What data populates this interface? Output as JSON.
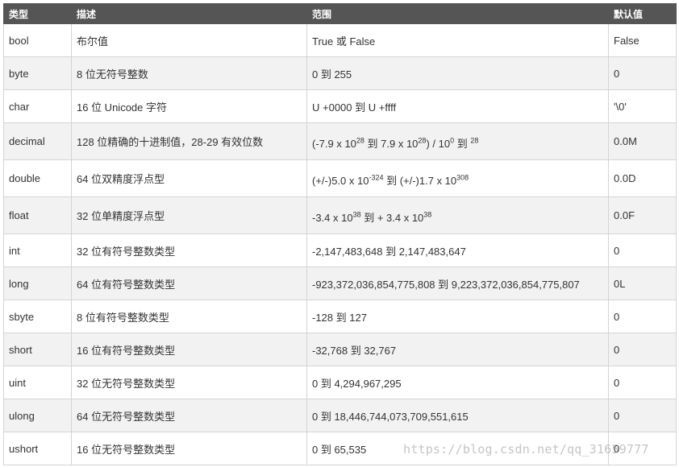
{
  "header": {
    "type": "类型",
    "desc": "描述",
    "range": "范围",
    "default": "默认值"
  },
  "rows": [
    {
      "type": "bool",
      "desc": "布尔值",
      "range_text": "True 或 False",
      "default": "False"
    },
    {
      "type": "byte",
      "desc": "8 位无符号整数",
      "range_text": "0 到 255",
      "default": "0"
    },
    {
      "type": "char",
      "desc": "16 位 Unicode 字符",
      "range_text": "U +0000 到 U +ffff",
      "default": "'\\0'"
    },
    {
      "type": "decimal",
      "desc": "128 位精确的十进制值，28-29 有效位数",
      "range_parts": [
        "(-7.9 x 10",
        "28",
        " 到 7.9 x 10",
        "28",
        ") / 10",
        "0",
        " 到 ",
        "28",
        ""
      ],
      "default": "0.0M"
    },
    {
      "type": "double",
      "desc": "64 位双精度浮点型",
      "range_parts": [
        "(+/-)5.0 x 10",
        "-324",
        " 到 (+/-)1.7 x 10",
        "308",
        ""
      ],
      "default": "0.0D"
    },
    {
      "type": "float",
      "desc": "32 位单精度浮点型",
      "range_parts": [
        "-3.4 x 10",
        "38",
        " 到 + 3.4 x 10",
        "38",
        ""
      ],
      "default": "0.0F"
    },
    {
      "type": "int",
      "desc": "32 位有符号整数类型",
      "range_text": "-2,147,483,648 到 2,147,483,647",
      "default": "0"
    },
    {
      "type": "long",
      "desc": "64 位有符号整数类型",
      "range_text": "-923,372,036,854,775,808 到 9,223,372,036,854,775,807",
      "default": "0L"
    },
    {
      "type": "sbyte",
      "desc": "8 位有符号整数类型",
      "range_text": "-128 到 127",
      "default": "0"
    },
    {
      "type": "short",
      "desc": "16 位有符号整数类型",
      "range_text": "-32,768 到 32,767",
      "default": "0"
    },
    {
      "type": "uint",
      "desc": "32 位无符号整数类型",
      "range_text": "0 到 4,294,967,295",
      "default": "0"
    },
    {
      "type": "ulong",
      "desc": "64 位无符号整数类型",
      "range_text": "0 到 18,446,744,073,709,551,615",
      "default": "0"
    },
    {
      "type": "ushort",
      "desc": "16 位无符号整数类型",
      "range_text": "0 到 65,535",
      "default": "0"
    }
  ],
  "watermark": "https://blog.csdn.net/qq_31659777"
}
